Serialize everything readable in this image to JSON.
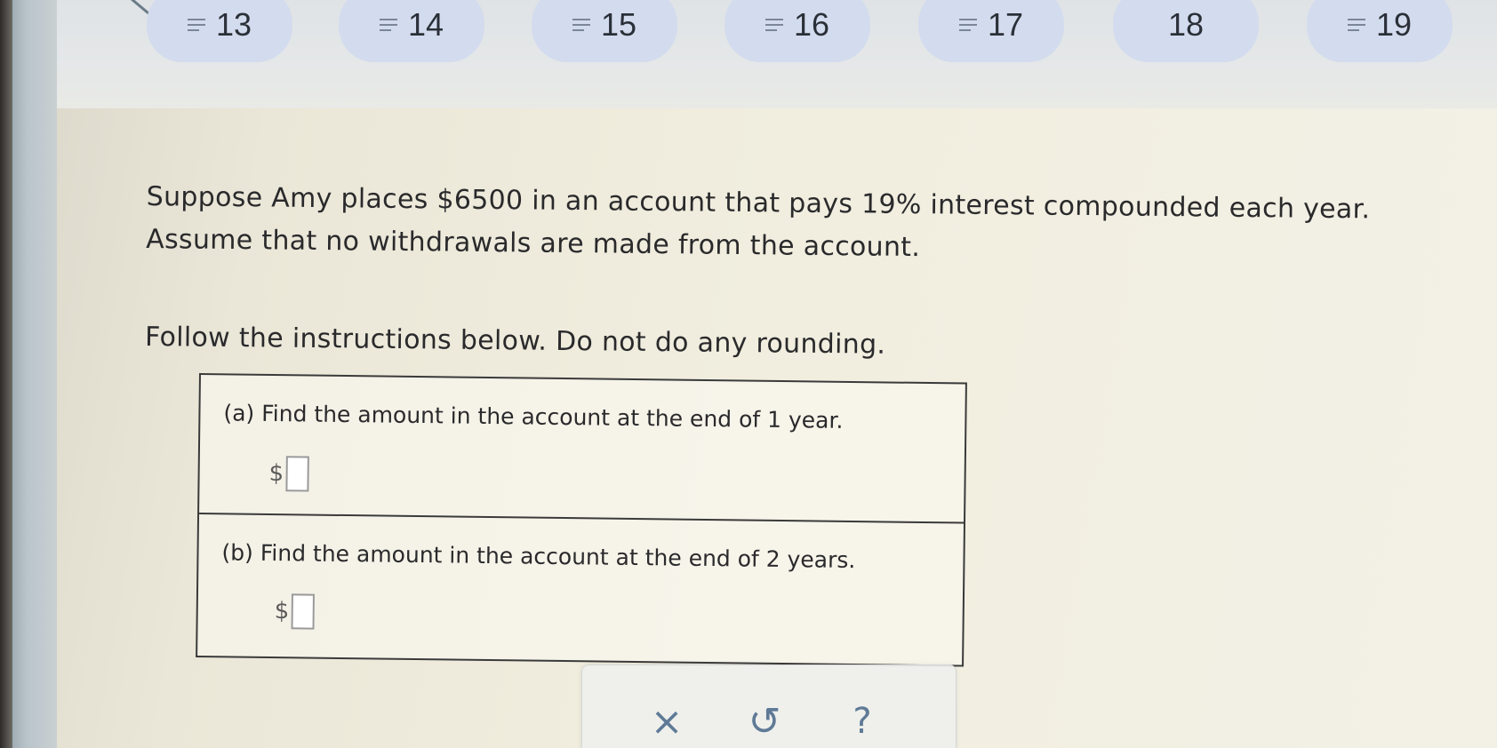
{
  "nav": {
    "questions": [
      {
        "number": "13",
        "has_lines_icon": true
      },
      {
        "number": "14",
        "has_lines_icon": true
      },
      {
        "number": "15",
        "has_lines_icon": true
      },
      {
        "number": "16",
        "has_lines_icon": true
      },
      {
        "number": "17",
        "has_lines_icon": true
      },
      {
        "number": "18",
        "has_lines_icon": false
      },
      {
        "number": "19",
        "has_lines_icon": true
      }
    ]
  },
  "problem": {
    "line1": "Suppose Amy places $6500 in an account that pays 19% interest compounded each year.",
    "line2": "Assume that no withdrawals are made from the account.",
    "instructions": "Follow the instructions below. Do not do any rounding."
  },
  "parts": [
    {
      "label": "(a) Find the amount in the account at the end of 1 year.",
      "currency": "$",
      "value": ""
    },
    {
      "label": "(b) Find the amount in the account at the end of 2 years.",
      "currency": "$",
      "value": ""
    }
  ],
  "toolbar": {
    "clear_icon": "×",
    "undo_icon": "↺",
    "help_icon": "?"
  },
  "colors": {
    "nav_pill": "#d3dcee",
    "tool_icon": "#5f7a96"
  }
}
